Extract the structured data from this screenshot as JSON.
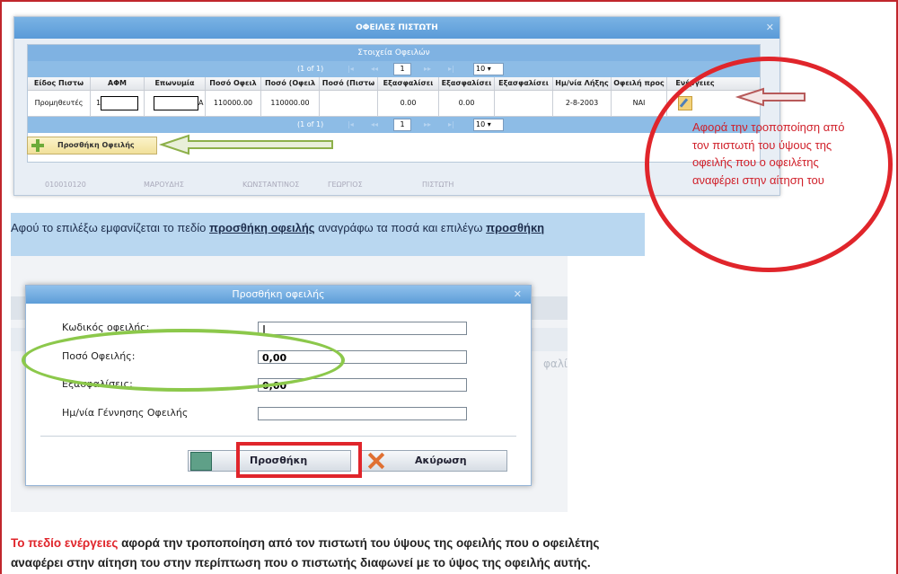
{
  "top_window": {
    "title": "ΟΦΕΙΛΕΣ ΠΙΣΤΩΤΗ",
    "close": "✕",
    "panel_title": "Στοιχεία Οφειλών",
    "pager": {
      "count": "(1 of 1)",
      "first": "|◂",
      "prev": "◂◂",
      "page": "1",
      "next": "▸▸",
      "last": "▸|",
      "page_size": "10 ▾"
    },
    "columns": [
      "Είδος Πιστω",
      "ΑΦΜ",
      "Επωνυμία",
      "Ποσό Οφειλ",
      "Ποσό (Οφειλ",
      "Ποσό (Πιστω",
      "Εξασφαλίσει",
      "Εξασφαλίσει",
      "Εξασφαλίσει",
      "Ημ/νία Λήξης",
      "Οφειλή προς",
      "Ενέργειες"
    ],
    "row": {
      "type": "Προμηθευτές",
      "afm_prefix": "1",
      "name_suffix": "Α",
      "amount1": "110000.00",
      "amount2": "110000.00",
      "amount3": "",
      "col7": "0.00",
      "col8": "0.00",
      "col9": "",
      "date": "2-8-2003",
      "flag": "ΝΑΙ"
    },
    "add_button": "Προσθήκη Οφειλής",
    "ghost_row": [
      "010010120",
      "ΜΑΡΟΥΔΗΣ",
      "ΚΩΝΣΤΑΝΤΙΝΟΣ",
      "ΓΕΩΡΓΙΟΣ",
      "ΠΙΣΤΩΤΗ"
    ]
  },
  "annotation_red": "Αφορά την τροποποίηση από τον πιστωτή του ύψους της οφειλής που ο οφειλέτης αναφέρει στην αίτηση του",
  "instruction": {
    "part1": "Αφού το επιλέξω εμφανίζεται το πεδίο ",
    "link1": "προσθήκη οφειλής",
    "part2": " αναγράφω τα ποσά και επιλέγω ",
    "link2": "προσθήκη"
  },
  "ghost_side_text": "φαλί",
  "dialog": {
    "title": "Προσθήκη οφειλής",
    "close": "✕",
    "fields": [
      {
        "label": "Κωδικός οφειλής:",
        "value": "|"
      },
      {
        "label": "Ποσό Οφειλής:",
        "value": "0,00"
      },
      {
        "label": "Εξασφαλίσεις:",
        "value": "0,00"
      },
      {
        "label": "Ημ/νία Γέννησης Οφειλής",
        "value": ""
      }
    ],
    "ok": "Προσθήκη",
    "cancel": "Ακύρωση"
  },
  "bottom": {
    "highlight": "Το πεδίο ενέργειες",
    "rest1": " αφορά την τροποποίηση  από τον πιστωτή του ύψους της οφειλής που ο οφειλέτης",
    "line2": "αναφέρει στην αίτηση του στην περίπτωση που ο πιστωτής διαφωνεί με το ύψος της οφειλής αυτής."
  }
}
